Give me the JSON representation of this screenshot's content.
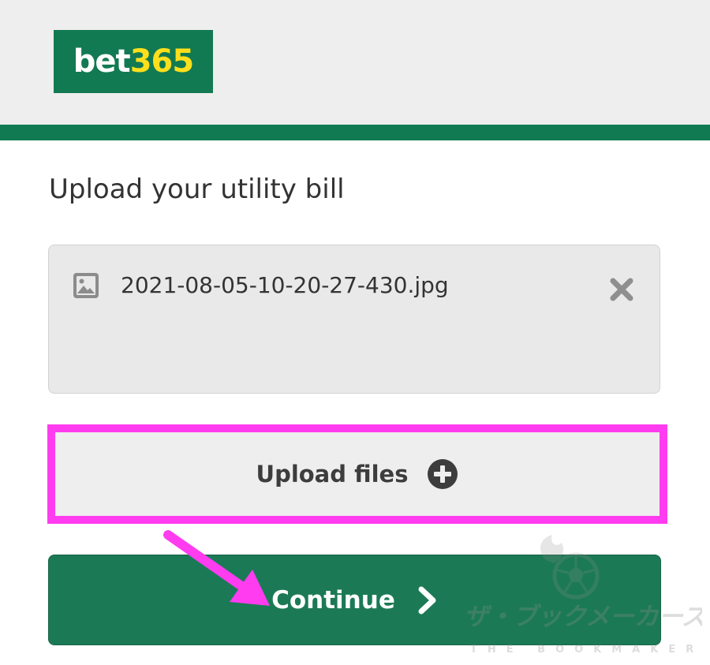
{
  "header": {
    "logo_left": "bet",
    "logo_right": "365"
  },
  "main": {
    "title": "Upload your utility bill",
    "file": {
      "name": "2021-08-05-10-20-27-430.jpg",
      "icon": "image-file-icon",
      "remove_icon": "close-icon"
    },
    "upload_button": {
      "label": "Upload files",
      "icon": "plus-circle-icon"
    },
    "continue_button": {
      "label": "Continue",
      "icon": "chevron-right-icon"
    }
  },
  "watermark": {
    "text_jp": "ザ・ブックメーカーズ",
    "text_en": "THE BOOKMAKERS"
  },
  "colors": {
    "brand_green": "#127a52",
    "brand_yellow": "#ffdf1b",
    "highlight_magenta": "#ff3cf0",
    "continue_green": "#1b7a55"
  }
}
